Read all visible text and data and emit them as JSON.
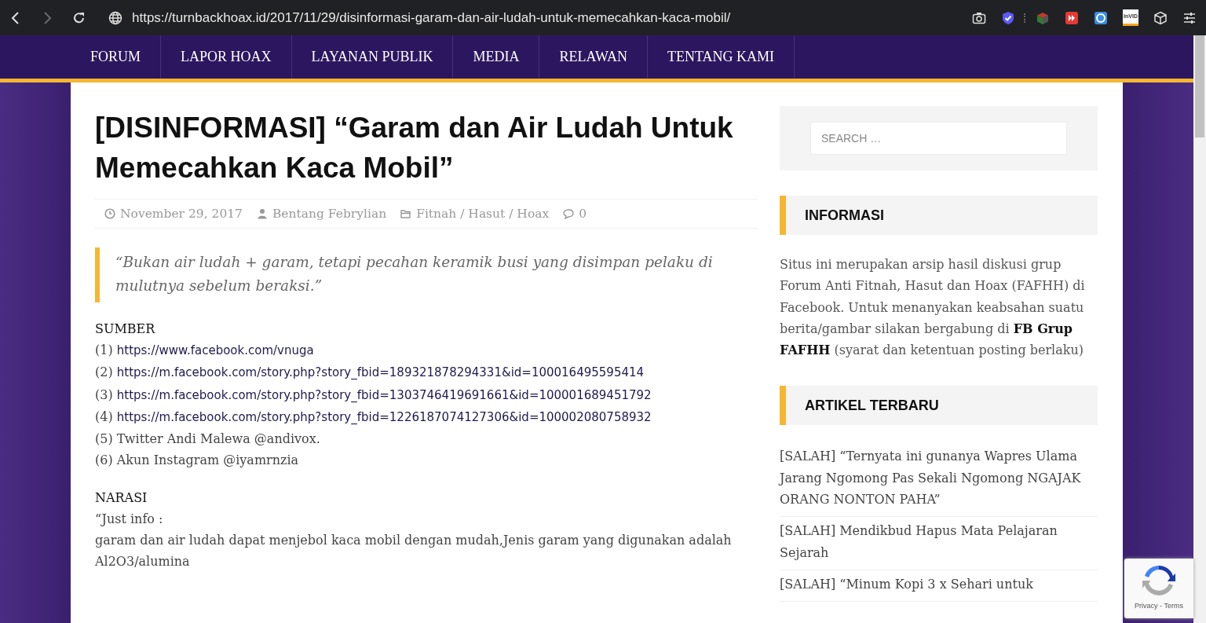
{
  "browser": {
    "nav_buttons": [
      {
        "kind": "back",
        "disabled": false
      },
      {
        "kind": "forward",
        "disabled": true
      },
      {
        "kind": "reload",
        "disabled": false
      }
    ],
    "url": "https://turnbackhoax.id/2017/11/29/disinformasi-garam-dan-air-ludah-untuk-memecahkan-kaca-mobil/",
    "extensions": [
      {
        "kind": "camera"
      },
      {
        "kind": "shield"
      },
      {
        "kind": "box"
      },
      {
        "kind": "play"
      },
      {
        "kind": "circle"
      },
      {
        "kind": "badge",
        "label": "InVID"
      },
      {
        "kind": "cube"
      },
      {
        "kind": "sliders"
      }
    ]
  },
  "site_nav": {
    "items": [
      {
        "label": "FORUM"
      },
      {
        "label": "LAPOR HOAX"
      },
      {
        "label": "LAYANAN PUBLIK"
      },
      {
        "label": "MEDIA"
      },
      {
        "label": "RELAWAN"
      },
      {
        "label": "TENTANG KAMI"
      }
    ]
  },
  "article": {
    "title": "[DISINFORMASI] “Garam dan Air Ludah Untuk Memecahkan Kaca Mobil”",
    "meta": {
      "date": "November 29, 2017",
      "author": "Bentang Febrylian",
      "category": "Fitnah / Hasut / Hoax",
      "comments": "0"
    },
    "quote": "“Bukan air ludah + garam, tetapi pecahan keramik busi yang disimpan pelaku di mulutnya sebelum beraksi.”",
    "sections": [
      {
        "heading": "SUMBER",
        "lines": [
          {
            "number": "(1)",
            "link": "https://www.facebook.com/vnuga"
          },
          {
            "number": "(2)",
            "link": "https://m.facebook.com/story.php?story_fbid=189321878294331&id=100016495595414"
          },
          {
            "number": "(3)",
            "link": "https://m.facebook.com/story.php?story_fbid=1303746419691661&id=100001689451792"
          },
          {
            "number": "(4)",
            "link": "https://m.facebook.com/story.php?story_fbid=1226187074127306&id=100002080758932"
          },
          {
            "number": "(5)",
            "text": "Twitter Andi Malewa @andivox."
          },
          {
            "number": "(6)",
            "text": "Akun Instagram @iyamrnzia"
          }
        ]
      },
      {
        "heading": "NARASI",
        "lines": [
          {
            "text": "“Just info :"
          },
          {
            "text": "garam dan air ludah dapat menjebol kaca mobil dengan mudah,Jenis garam yang digunakan adalah Al2O3/alumina"
          }
        ]
      }
    ]
  },
  "sidebar": {
    "search": {
      "placeholder": "SEARCH …"
    },
    "widgets": [
      {
        "kind": "text",
        "title": "INFORMASI",
        "text": "Situs ini merupakan arsip hasil diskusi grup Forum Anti Fitnah, Hasut dan Hoax (FAFHH) di Facebook. Untuk menanyakan keabsahan suatu berita/gambar silakan bergabung di **FB Grup FAFHH** (syarat dan ketentuan posting berlaku)"
      },
      {
        "kind": "posts",
        "title": "ARTIKEL TERBARU",
        "posts": [
          {
            "title": "[SALAH] “Ternyata ini gunanya Wapres Ulama Jarang Ngomong Pas Sekali Ngomong NGAJAK ORANG NONTON PAHA”"
          },
          {
            "title": "[SALAH] Mendikbud Hapus Mata Pelajaran Sejarah"
          },
          {
            "title": "[SALAH] “Minum Kopi 3 x Sehari untuk"
          }
        ]
      }
    ]
  },
  "recaptcha": {
    "label": "Privacy - Terms"
  }
}
